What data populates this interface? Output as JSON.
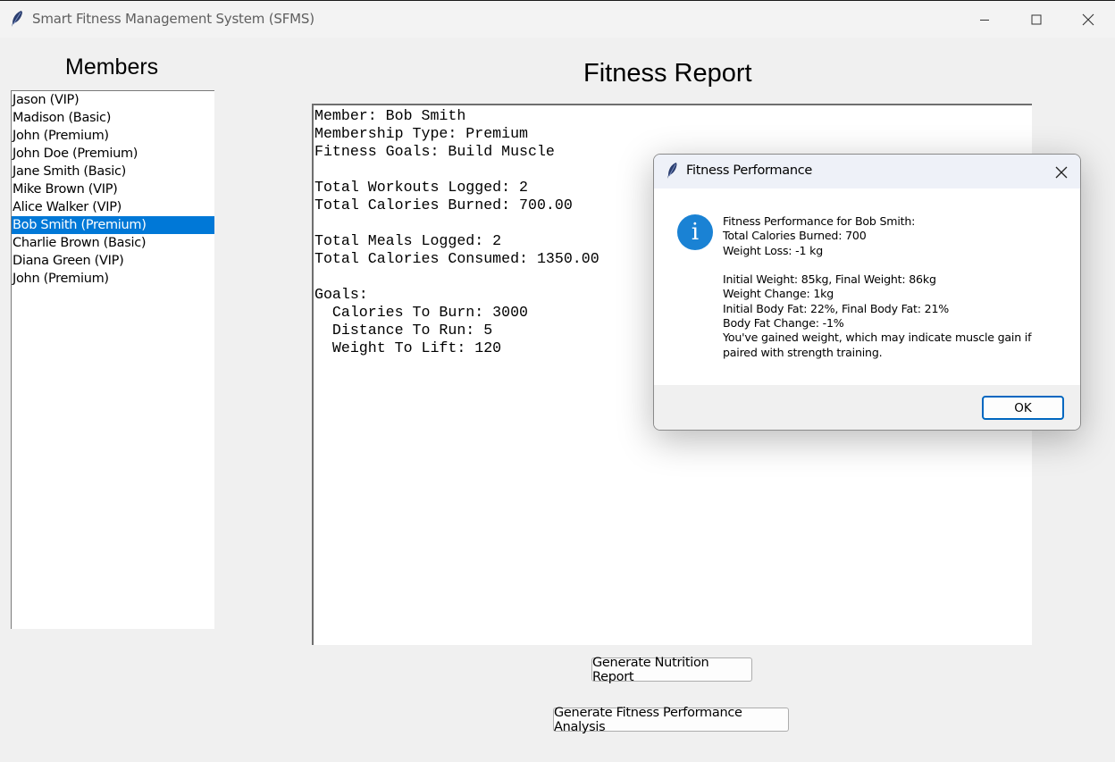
{
  "window": {
    "title": "Smart Fitness Management System (SFMS)",
    "app_icon": "feather-icon"
  },
  "members": {
    "title": "Members",
    "selected_index": 7,
    "items": [
      "Jason (VIP)",
      "Madison (Basic)",
      "John (Premium)",
      "John Doe (Premium)",
      "Jane Smith (Basic)",
      "Mike Brown (VIP)",
      "Alice Walker (VIP)",
      "Bob Smith (Premium)",
      "Charlie Brown (Basic)",
      "Diana Green (VIP)",
      "John (Premium)"
    ]
  },
  "report": {
    "title": "Fitness Report",
    "lines": [
      "Member: Bob Smith",
      "Membership Type: Premium",
      "Fitness Goals: Build Muscle",
      "",
      "Total Workouts Logged: 2",
      "Total Calories Burned: 700.00",
      "",
      "Total Meals Logged: 2",
      "Total Calories Consumed: 1350.00",
      "",
      "Goals:",
      "  Calories To Burn: 3000",
      "  Distance To Run: 5",
      "  Weight To Lift: 120"
    ]
  },
  "buttons": {
    "nutrition": "Generate Nutrition Report",
    "analysis": "Generate Fitness Performance Analysis"
  },
  "dialog": {
    "title": "Fitness Performance",
    "icon": "info-icon",
    "ok_label": "OK",
    "lines": [
      "Fitness Performance for Bob Smith:",
      "Total Calories Burned: 700",
      "Weight Loss: -1 kg",
      "",
      "Initial Weight: 85kg, Final Weight: 86kg",
      "Weight Change: 1kg",
      "Initial Body Fat: 22%, Final Body Fat: 21%",
      "Body Fat Change: -1%",
      "You've gained weight, which may indicate muscle gain if",
      "paired with strength training."
    ]
  },
  "colors": {
    "selection": "#0078d7",
    "info_icon": "#1a82d4",
    "ok_border": "#0067c0"
  }
}
